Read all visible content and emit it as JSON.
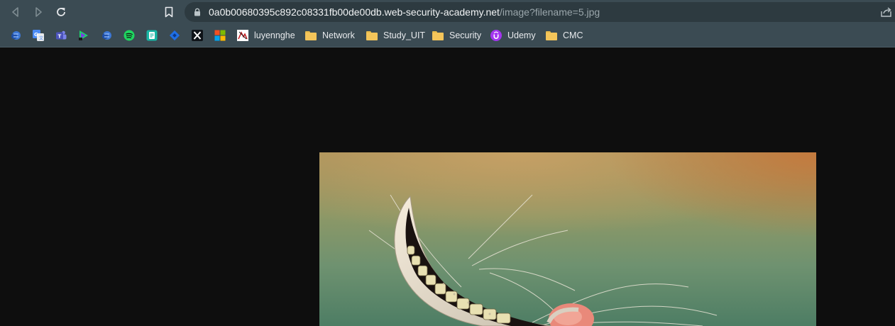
{
  "browser": {
    "nav": {
      "back_icon": "back-arrow-icon",
      "forward_icon": "forward-arrow-icon",
      "reload_icon": "reload-icon",
      "bookmark_icon": "bookmark-icon"
    },
    "address_bar": {
      "host": "0a0b00680395c892c08331fb00de00db.web-security-academy.net",
      "path": "/image?filename=5.jpg",
      "share_icon": "share-icon"
    },
    "bookmarks": [
      {
        "icon": "site-icon-1",
        "label": ""
      },
      {
        "icon": "google-translate-icon",
        "label": ""
      },
      {
        "icon": "teams-icon",
        "label": ""
      },
      {
        "icon": "media-player-icon",
        "label": ""
      },
      {
        "icon": "site-icon-2",
        "label": ""
      },
      {
        "icon": "spotify-icon",
        "label": ""
      },
      {
        "icon": "quiz-icon",
        "label": ""
      },
      {
        "icon": "diamond-icon",
        "label": ""
      },
      {
        "icon": "x-icon",
        "label": ""
      },
      {
        "icon": "microsoft-icon",
        "label": ""
      },
      {
        "icon": "luyennghe-icon",
        "label": "luyennghe"
      },
      {
        "icon": "folder-icon",
        "label": "Network"
      },
      {
        "icon": "folder-icon",
        "label": "Study_UIT"
      },
      {
        "icon": "folder-icon",
        "label": "Security"
      },
      {
        "icon": "udemy-icon",
        "label": "Udemy"
      },
      {
        "icon": "folder-icon",
        "label": "CMC"
      }
    ]
  },
  "page": {
    "image": "cheshire-cat-grin-image"
  },
  "colors": {
    "toolbar": "#3b4b53",
    "omnibox": "#2d3a40",
    "page_bg": "#0e0e0e"
  }
}
